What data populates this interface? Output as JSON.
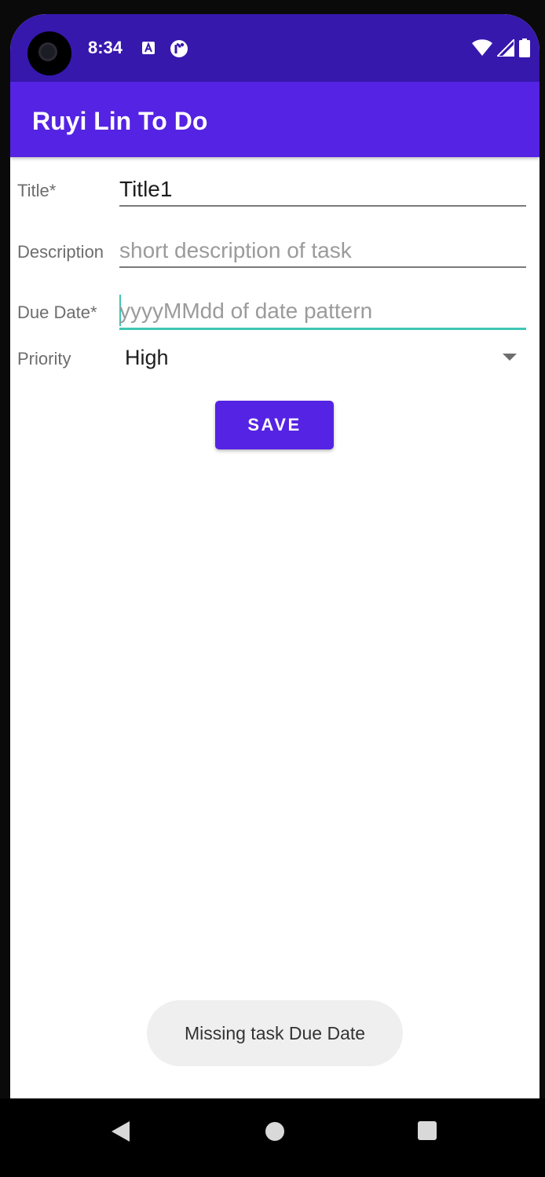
{
  "status_bar": {
    "time": "8:34",
    "icons": [
      "camera-icon",
      "accessibility-a-icon",
      "notification-p-icon",
      "wifi-icon",
      "signal-icon",
      "battery-icon"
    ]
  },
  "app_bar": {
    "title": "Ruyi Lin To Do"
  },
  "form": {
    "title": {
      "label": "Title*",
      "value": "Title1",
      "placeholder": ""
    },
    "description": {
      "label": "Description",
      "value": "",
      "placeholder": "short description of task"
    },
    "due_date": {
      "label": "Due Date*",
      "value": "",
      "placeholder": "yyyyMMdd of date pattern"
    },
    "priority": {
      "label": "Priority",
      "selected": "High"
    },
    "save_label": "SAVE"
  },
  "toast": {
    "message": "Missing task Due Date"
  },
  "colors": {
    "status_bar": "#3618ad",
    "app_bar": "#5523e3",
    "button": "#5523e3",
    "focus_accent": "#3fc5b5"
  },
  "nav_bar": {
    "icons": [
      "back-icon",
      "home-icon",
      "recents-icon"
    ]
  }
}
